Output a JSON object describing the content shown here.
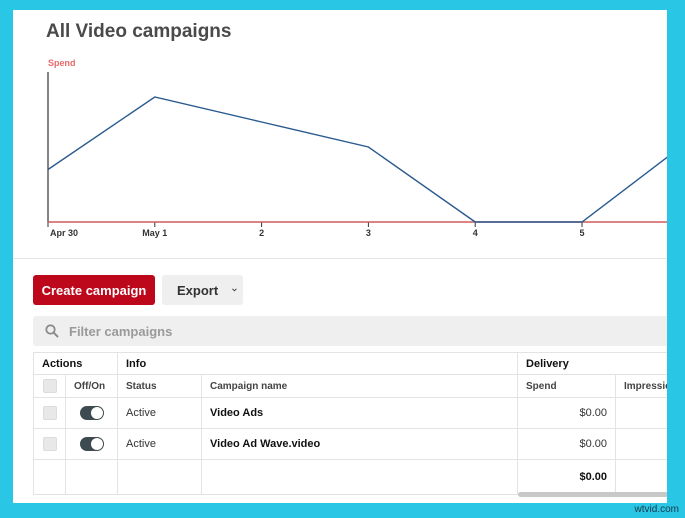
{
  "header": {
    "title": "All Video campaigns"
  },
  "chart_data": {
    "type": "line",
    "ylabel": "Spend",
    "categories": [
      "Apr 30",
      "May 1",
      "2",
      "3",
      "4",
      "5"
    ],
    "series": [
      {
        "values": [
          0.42,
          1.0,
          0.8,
          0.6,
          0.0,
          0.0,
          0.65
        ],
        "color": "#2a5a8e"
      },
      {
        "values": [
          0,
          0,
          0,
          0,
          0,
          0,
          0
        ],
        "color": "#d05a5a"
      }
    ],
    "ylim": [
      0,
      1.2
    ],
    "grid": false
  },
  "toolbar": {
    "create_label": "Create campaign",
    "export_label": "Export"
  },
  "filter": {
    "placeholder": "Filter campaigns"
  },
  "table": {
    "groups": {
      "actions": "Actions",
      "info": "Info",
      "delivery": "Delivery"
    },
    "columns": {
      "offon": "Off/On",
      "status": "Status",
      "name": "Campaign name",
      "spend": "Spend",
      "impressions": "Impressio"
    },
    "rows": [
      {
        "status": "Active",
        "name": "Video Ads",
        "spend": "$0.00"
      },
      {
        "status": "Active",
        "name": "Video Ad Wave.video",
        "spend": "$0.00"
      }
    ],
    "total_spend": "$0.00"
  },
  "colors": {
    "accent": "#bd081c",
    "frame": "#29c6e6",
    "line": "#2a5a8e"
  },
  "watermark": "wtvid.com"
}
